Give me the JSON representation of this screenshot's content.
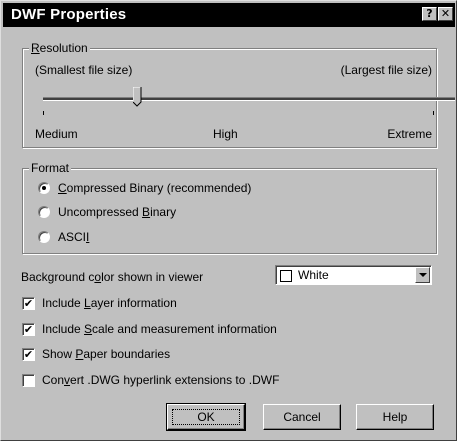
{
  "window": {
    "title": "DWF Properties",
    "help_glyph": "?",
    "close_glyph": "✕"
  },
  "resolution": {
    "legend_u": "R",
    "legend_rest": "esolution",
    "smallest_label": "(Smallest file size)",
    "largest_label": "(Largest file size)",
    "low_label": "Medium",
    "mid_label": "High",
    "high_label": "Extreme",
    "slider_level": 0.23
  },
  "format": {
    "legend": "Format",
    "options": [
      {
        "u": "C",
        "rest": "ompressed Binary (recommended)",
        "selected": true
      },
      {
        "pre": "Uncompressed ",
        "u": "B",
        "rest": "inary",
        "selected": false
      },
      {
        "pre": "ASCI",
        "u": "I",
        "rest": "",
        "selected": false
      }
    ]
  },
  "background": {
    "label_pre": "Background c",
    "label_u": "o",
    "label_rest": "lor shown in viewer",
    "selected_value": "White",
    "swatch_color": "#ffffff"
  },
  "checks": [
    {
      "pre": "Include ",
      "u": "L",
      "rest": "ayer information",
      "checked": true
    },
    {
      "pre": "Include ",
      "u": "S",
      "rest": "cale and measurement information",
      "checked": true
    },
    {
      "pre": "Show ",
      "u": "P",
      "rest": "aper boundaries",
      "checked": true
    },
    {
      "pre": "Con",
      "u": "v",
      "rest": "ert .DWG hyperlink extensions to .DWF",
      "checked": false
    }
  ],
  "buttons": {
    "ok": "OK",
    "cancel": "Cancel",
    "help": "Help"
  },
  "check_glyph": "✔"
}
